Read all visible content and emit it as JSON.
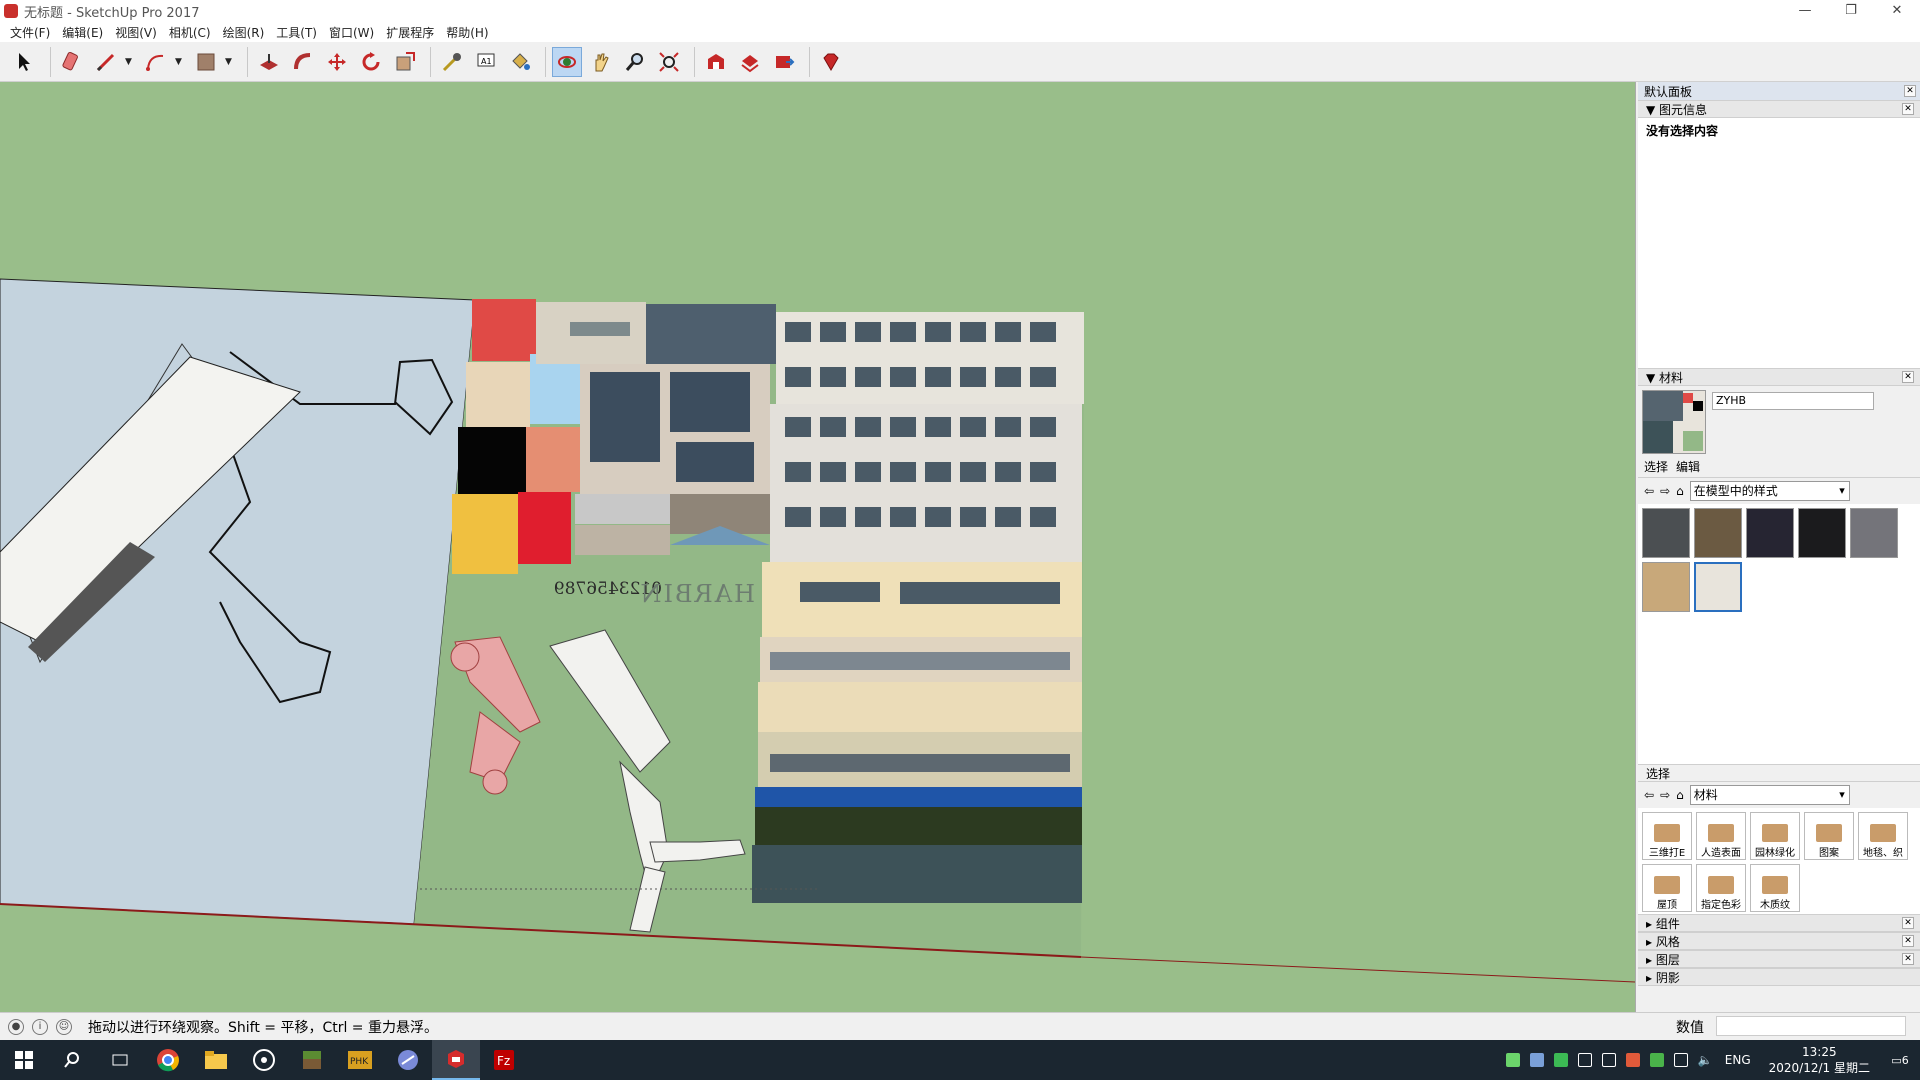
{
  "window": {
    "title": "无标题 - SketchUp Pro 2017",
    "controls": {
      "minimize": "—",
      "restore": "❐",
      "close": "✕"
    }
  },
  "menu": [
    "文件(F)",
    "编辑(E)",
    "视图(V)",
    "相机(C)",
    "绘图(R)",
    "工具(T)",
    "窗口(W)",
    "扩展程序",
    "帮助(H)"
  ],
  "toolbar": {
    "tools": [
      "select-icon",
      "eraser-icon",
      "pencil-icon",
      "arc-icon",
      "rectangle-icon",
      "push-pull-icon",
      "follow-me-icon",
      "move-icon",
      "rotate-icon",
      "scale-icon",
      "tape-measure-icon",
      "text-icon",
      "paint-bucket-icon",
      "orbit-icon",
      "pan-icon",
      "zoom-icon",
      "zoom-extents-icon",
      "warehouse-icon",
      "share-model-icon",
      "extension-warehouse-icon",
      "ruby-icon"
    ],
    "active_tool": "orbit-icon"
  },
  "viewport": {
    "background": "#99be8a",
    "texture_text": {
      "number_line": "0123456789",
      "city_name": "HARBIN"
    }
  },
  "tray": {
    "title": "默认面板",
    "entity_info": {
      "header": "图元信息",
      "body": "没有选择内容"
    },
    "materials": {
      "header": "材料",
      "current_name": "ZYHB",
      "tabs": [
        "选择",
        "编辑"
      ],
      "collection": "在模型中的样式",
      "swatch_colors": [
        "#4b4f52",
        "#6b5a42",
        "#262532",
        "#1b1b1d",
        "#74747a",
        "#c8a87a"
      ],
      "secondary_select": {
        "header": "选择",
        "collection": "材料",
        "library": [
          "三维打E",
          "人造表面",
          "园林绿化",
          "图案",
          "地毯、织",
          "屋顶",
          "指定色彩",
          "木质纹"
        ]
      }
    },
    "collapsed_sections": [
      "组件",
      "风格",
      "图层",
      "阴影"
    ]
  },
  "status": {
    "message": "拖动以进行环绕观察。Shift = 平移，Ctrl = 重力悬浮。",
    "measure_label": "数值",
    "measure_value": ""
  },
  "taskbar": {
    "apps": [
      "windows-start-icon",
      "search-icon",
      "task-view-icon",
      "chrome-icon",
      "file-explorer-icon",
      "app-circle-icon",
      "minecraft-icon",
      "phk-icon",
      "launcher-icon",
      "sketchup-icon",
      "filezilla-icon"
    ],
    "language": "ENG",
    "time": "13:25",
    "date": "2020/12/1 星期二",
    "notifications": "6"
  }
}
